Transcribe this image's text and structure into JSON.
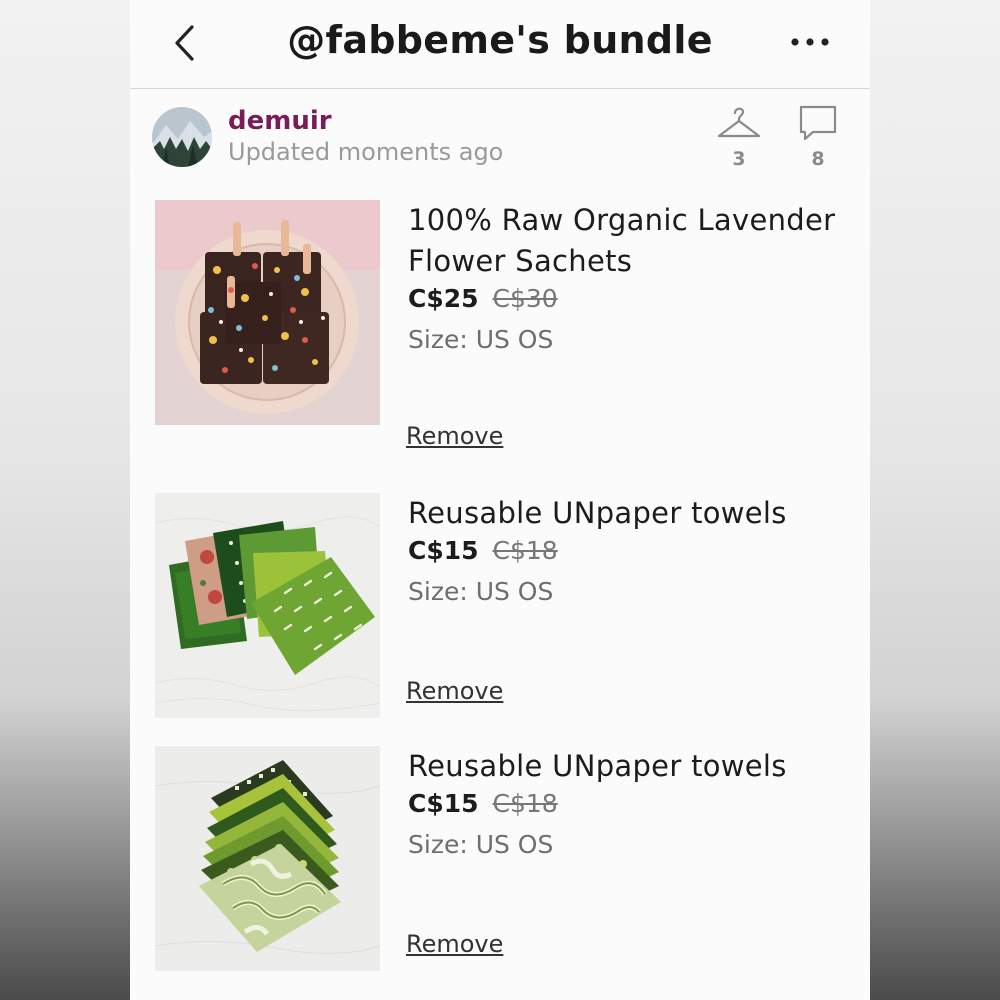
{
  "header": {
    "title": "@fabbeme's bundle"
  },
  "seller": {
    "username": "demuir",
    "updated": "Updated moments ago",
    "likes": "3",
    "comments": "8"
  },
  "items": [
    {
      "title": "100% Raw Organic Lavender Flower Sachets",
      "price": "C$25",
      "original_price": "C$30",
      "size": "Size: US OS",
      "remove_label": "Remove"
    },
    {
      "title": "Reusable UNpaper towels",
      "price": "C$15",
      "original_price": "C$18",
      "size": "Size: US OS",
      "remove_label": "Remove"
    },
    {
      "title": "Reusable UNpaper towels",
      "price": "C$15",
      "original_price": "C$18",
      "size": "Size: US OS",
      "remove_label": "Remove"
    }
  ],
  "colors": {
    "username": "#7a1c57",
    "text": "#1c1c1c",
    "muted": "#9a9a9a"
  },
  "icons": [
    "chevron-left-icon",
    "more-dots-icon",
    "hanger-icon",
    "comment-icon"
  ]
}
